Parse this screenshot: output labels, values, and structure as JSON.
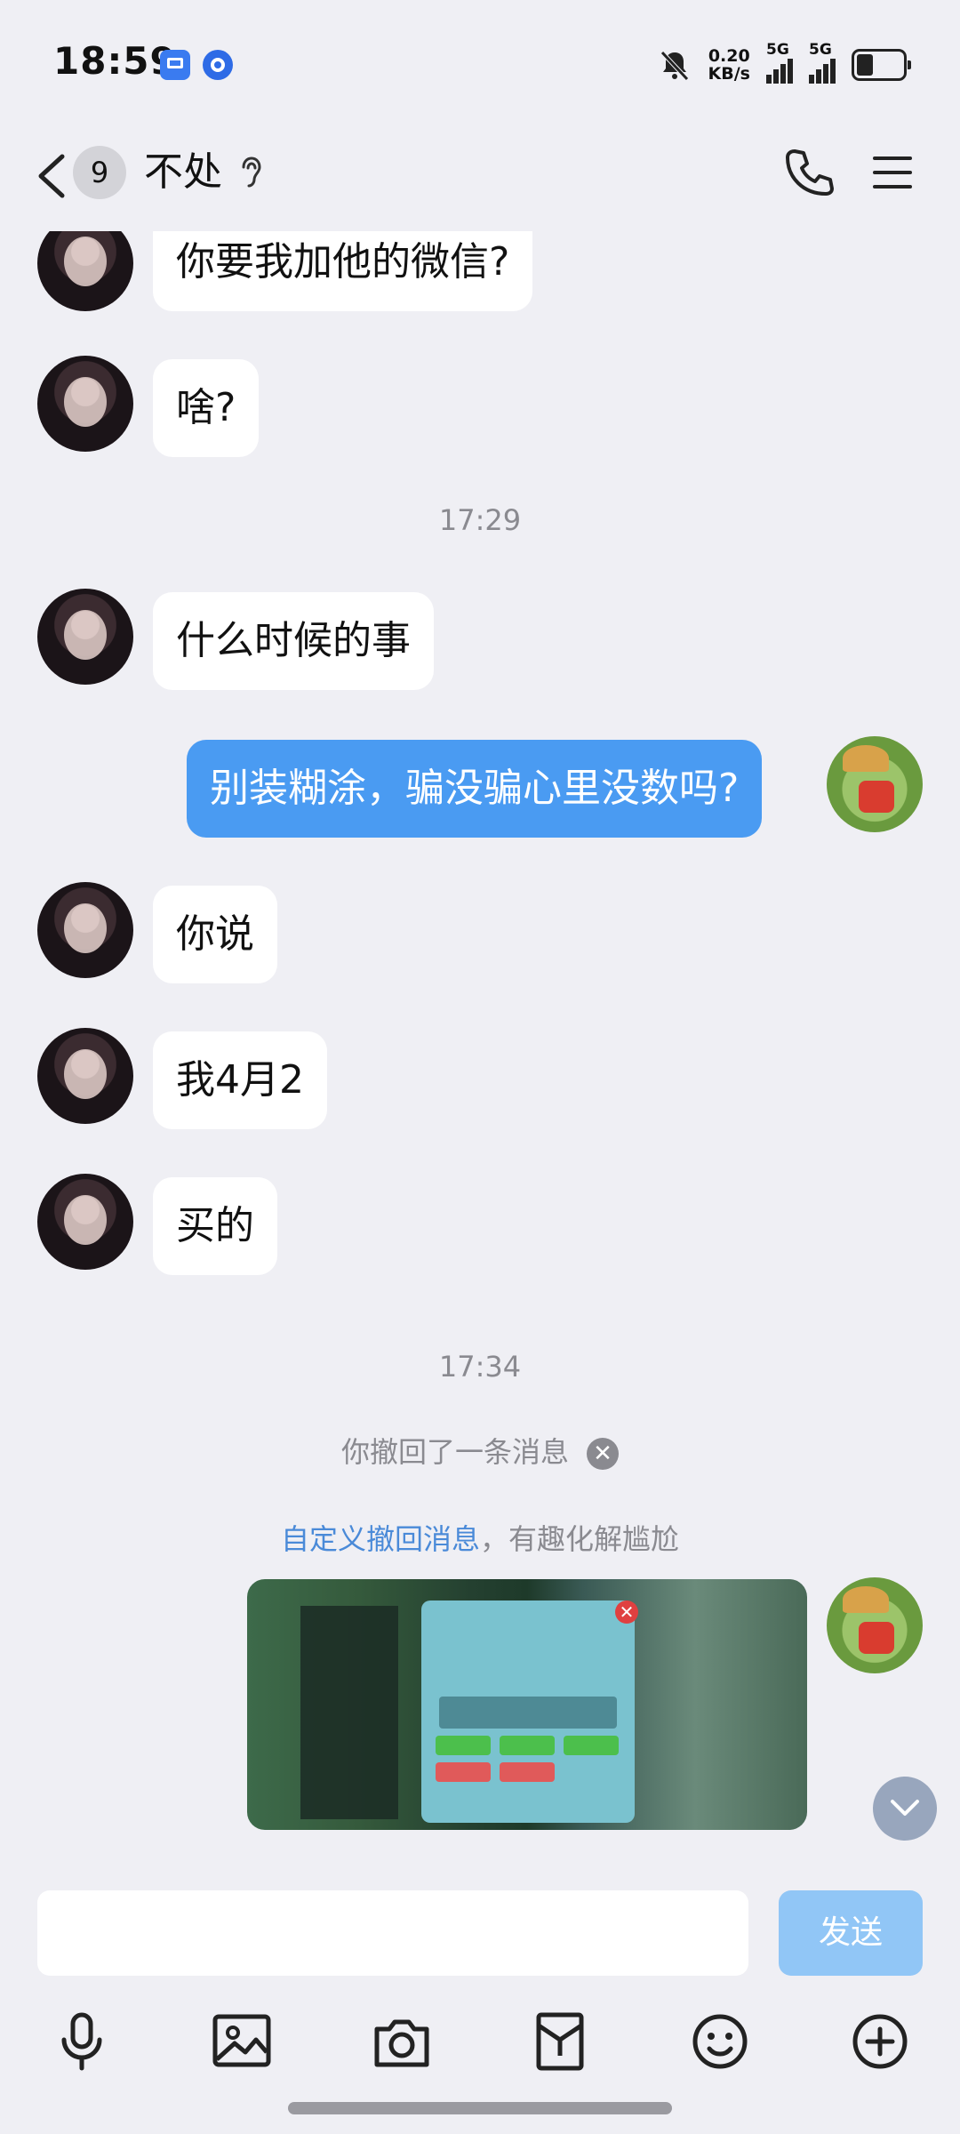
{
  "status_bar": {
    "time": "18:59",
    "net_speed_value": "0.20",
    "net_speed_unit": "KB/s",
    "signal1_label": "5G",
    "signal2_label": "5G"
  },
  "header": {
    "unread_count": "9",
    "title": "不处"
  },
  "messages": {
    "m1": "你要我加他的微信?",
    "m2": "啥?",
    "t1": "17:29",
    "m3": "什么时候的事",
    "m4": "别装糊涂，骗没骗心里没数吗?",
    "m5": "你说",
    "m6": "我4月2",
    "m7": "买的",
    "t2": "17:34",
    "recall_notice": "你撤回了一条消息",
    "custom_recall_link": "自定义撤回消息",
    "custom_recall_rest": "，有趣化解尴尬"
  },
  "input": {
    "placeholder": "",
    "send_label": "发送"
  },
  "toolbar": {
    "icons": [
      "microphone-icon",
      "image-icon",
      "camera-icon",
      "red-packet-icon",
      "emoji-icon",
      "plus-icon"
    ]
  },
  "colors": {
    "background": "#efeff4",
    "my_bubble": "#4a9bf2",
    "their_bubble": "#ffffff",
    "send_button": "#91c6f6",
    "link": "#4a8ad8"
  }
}
